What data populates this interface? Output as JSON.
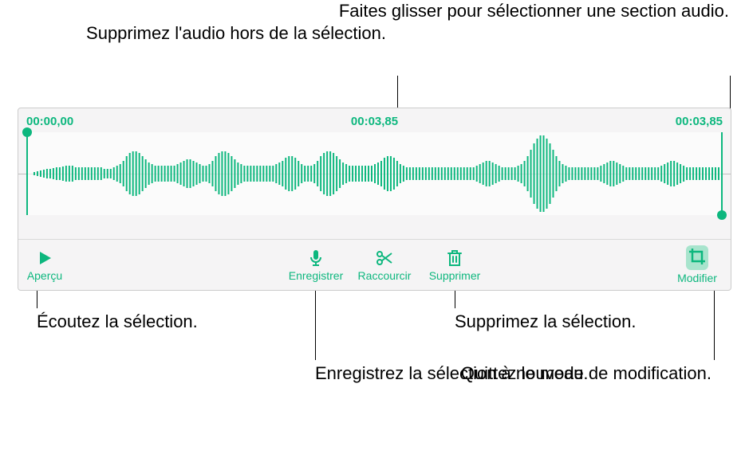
{
  "callouts": {
    "remove_outside": "Supprimez l'audio hors de la sélection.",
    "drag_select": "Faites glisser pour sélectionner une section audio.",
    "listen": "Écoutez la sélection.",
    "record_again": "Enregistrez la sélection à nouveau.",
    "delete_sel": "Supprimez la sélection.",
    "exit_edit": "Quittez le mode de modification."
  },
  "timestamps": {
    "start": "00:00,00",
    "playhead": "00:03,85",
    "end": "00:03,85"
  },
  "toolbar": {
    "preview": "Aperçu",
    "record": "Enregistrer",
    "trim": "Raccourcir",
    "delete": "Supprimer",
    "edit": "Modifier"
  },
  "colors": {
    "accent": "#0db77e"
  }
}
